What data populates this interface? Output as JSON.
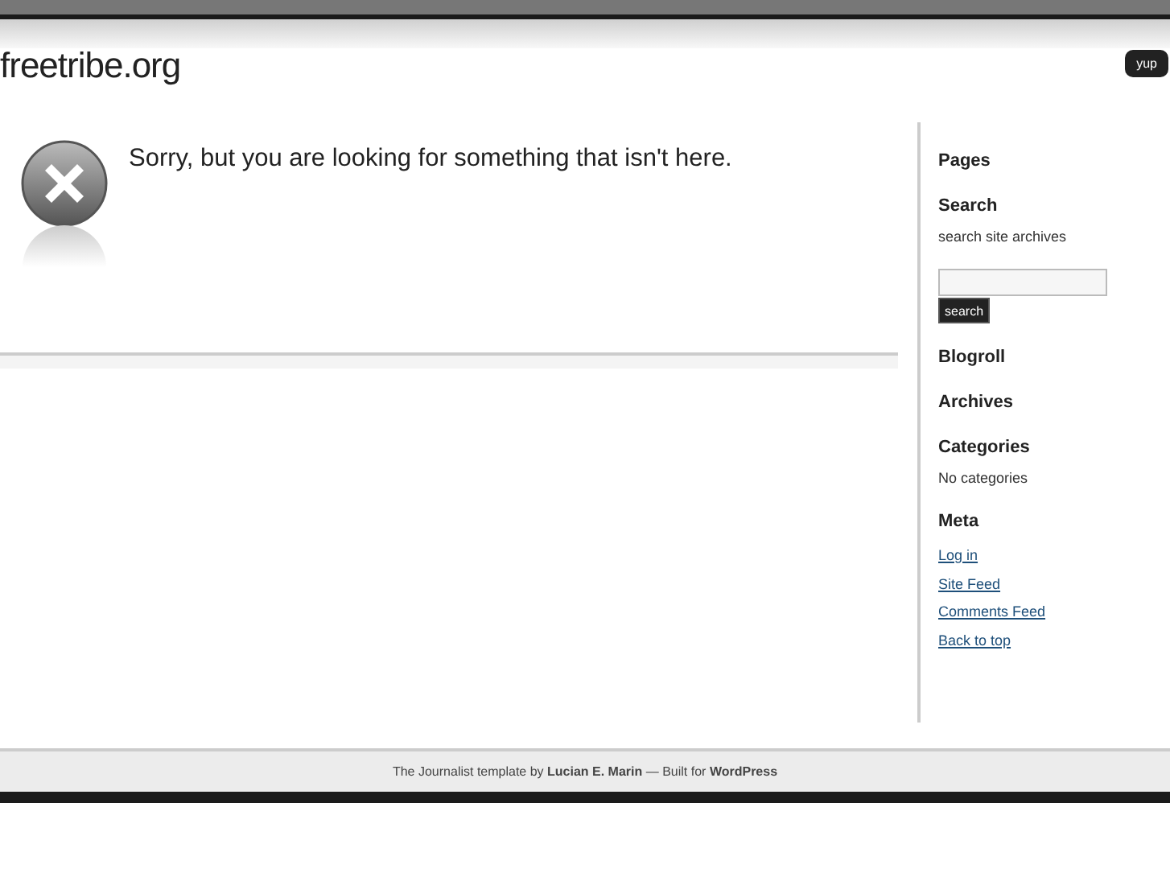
{
  "site_title": "freetribe.org",
  "badge": "yup",
  "message": "Sorry, but you are looking for something that isn't here.",
  "sidebar": [
    {
      "kind": "heading",
      "text": "Pages"
    },
    {
      "kind": "heading",
      "text": "Search"
    },
    {
      "kind": "text",
      "text": "search site archives"
    },
    {
      "kind": "search",
      "button": "search"
    },
    {
      "kind": "heading",
      "text": "Blogroll"
    },
    {
      "kind": "heading",
      "text": "Archives"
    },
    {
      "kind": "heading",
      "text": "Categories"
    },
    {
      "kind": "text",
      "text": "No categories"
    },
    {
      "kind": "heading",
      "text": "Meta"
    },
    {
      "kind": "link",
      "text": "Log in"
    },
    {
      "kind": "link",
      "text": "Site Feed"
    },
    {
      "kind": "link",
      "text": "Comments Feed"
    },
    {
      "kind": "link",
      "text": "Back to top"
    }
  ],
  "footer": "The Journalist template by **Lucian E. Marin** — Built for **WordPress**"
}
